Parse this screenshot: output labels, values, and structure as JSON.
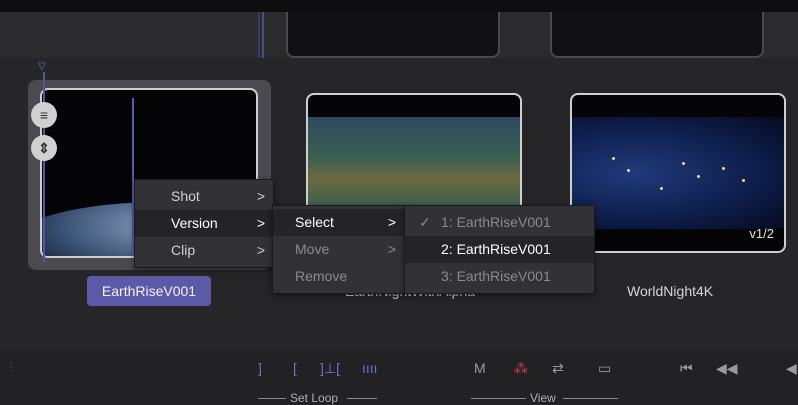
{
  "top_strip": {
    "thumbnails": [
      "",
      ""
    ]
  },
  "clips": [
    {
      "name": "EarthRiseV001",
      "selected": true
    },
    {
      "name": "EarthNightWithAlpha",
      "visible_name": "EarthNightWithAlpha"
    },
    {
      "name": "WorldNight4K",
      "version_badge": "v1/2"
    }
  ],
  "side_buttons": {
    "top_icon": "reorder-icon",
    "bottom_icon": "up-down-arrows-icon"
  },
  "context_menu": {
    "items": [
      {
        "label": "Shot",
        "arrow": ">"
      },
      {
        "label": "Version",
        "arrow": ">",
        "highlighted": true
      },
      {
        "label": "Clip",
        "arrow": ">"
      }
    ]
  },
  "version_submenu": {
    "items": [
      {
        "label": "Select",
        "arrow": ">",
        "highlighted": true
      },
      {
        "label": "Move",
        "arrow": ">",
        "disabled": true
      },
      {
        "label": "Remove",
        "disabled": true
      }
    ]
  },
  "select_submenu": {
    "items": [
      {
        "label": "1: EarthRiseV001",
        "checked": true,
        "check_mark": "✓",
        "disabled": true
      },
      {
        "label": "2: EarthRiseV001",
        "highlighted": true
      },
      {
        "label": "3: EarthRiseV001",
        "disabled": true
      }
    ]
  },
  "toolbar": {
    "set_loop": {
      "label": "Set Loop",
      "icons": [
        "loop-in-icon",
        "loop-out-icon",
        "loop-range-icon",
        "loop-clear-icon"
      ]
    },
    "view": {
      "label": "View",
      "m_label": "M",
      "icons": [
        "color-dots-icon",
        "swap-arrows-icon",
        "monitor-icon"
      ]
    },
    "transport": {
      "icons": [
        "skip-to-start-icon",
        "rewind-icon",
        "play-reverse-icon"
      ]
    }
  },
  "colors": {
    "accent": "#5a5aa8",
    "playhead": "#6e6ec8",
    "background": "#262628"
  }
}
